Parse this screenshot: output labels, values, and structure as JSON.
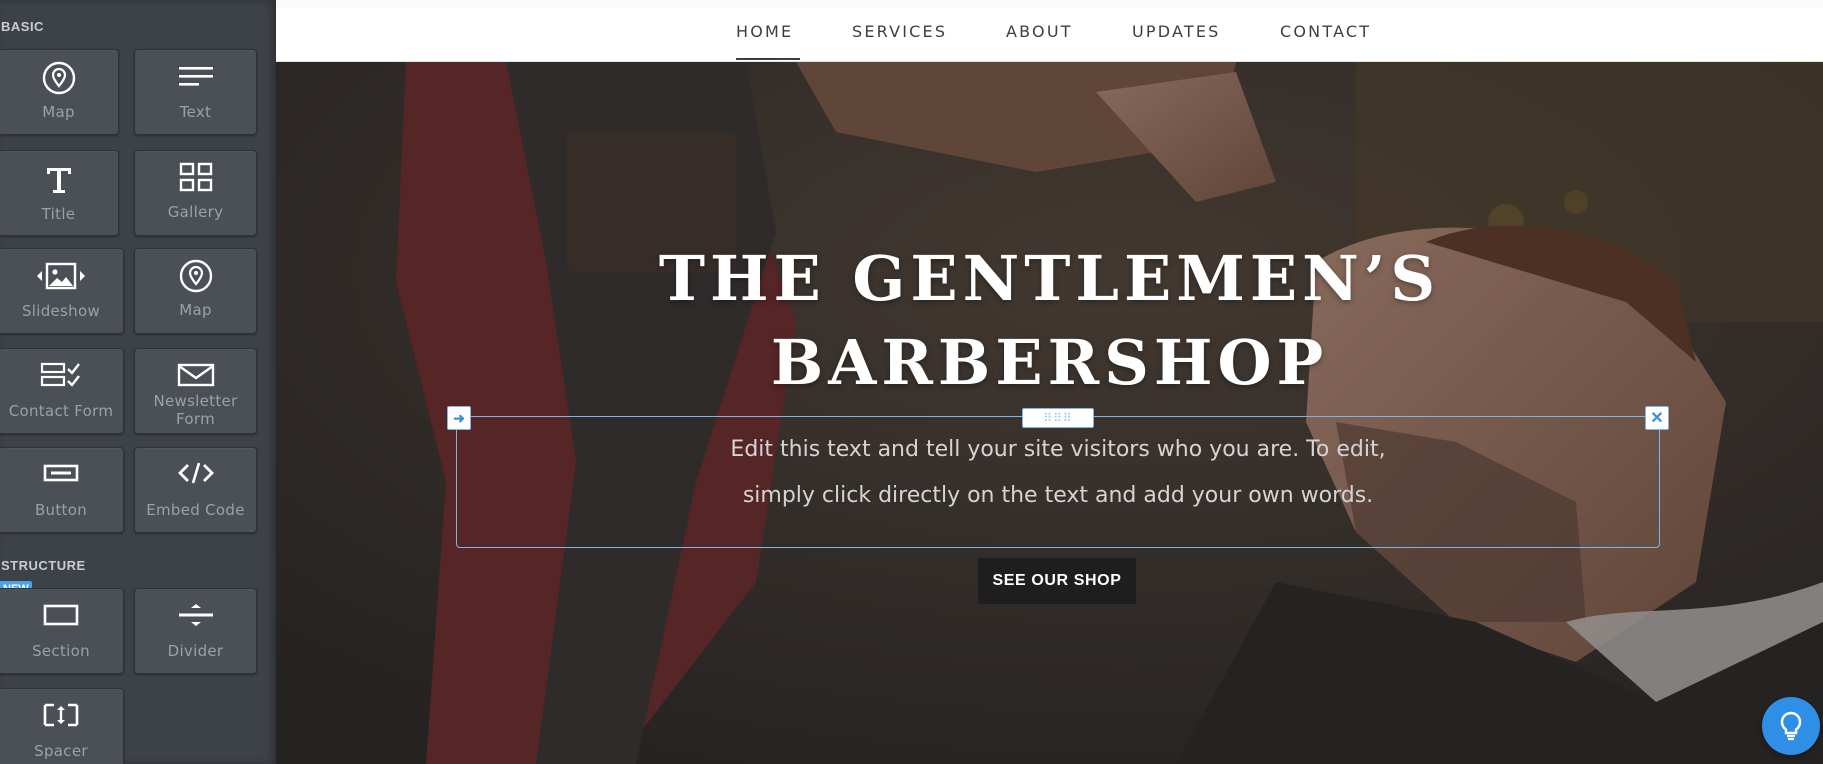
{
  "sidebar": {
    "basic_label": "BASIC",
    "structure_label": "STRUCTURE",
    "new_badge": "NEW",
    "tiles": [
      {
        "label": "Map",
        "icon": "map-pin-icon"
      },
      {
        "label": "Text",
        "icon": "text-lines-icon"
      },
      {
        "label": "Title",
        "icon": "title-t-icon"
      },
      {
        "label": "Gallery",
        "icon": "gallery-grid-icon"
      },
      {
        "label": "Slideshow",
        "icon": "slideshow-icon"
      },
      {
        "label": "Map",
        "icon": "map-pin-icon"
      },
      {
        "label": "Contact Form",
        "icon": "contact-form-icon"
      },
      {
        "label": "Newsletter Form",
        "icon": "envelope-icon"
      },
      {
        "label": "Button",
        "icon": "button-icon"
      },
      {
        "label": "Embed Code",
        "icon": "code-icon"
      },
      {
        "label": "Section",
        "icon": "section-icon"
      },
      {
        "label": "Divider",
        "icon": "divider-icon"
      },
      {
        "label": "Spacer",
        "icon": "spacer-icon"
      }
    ]
  },
  "nav": {
    "items": [
      "HOME",
      "SERVICES",
      "ABOUT",
      "UPDATES",
      "CONTACT"
    ],
    "active": "HOME"
  },
  "hero": {
    "title_line1": "THE GENTLEMEN’S",
    "title_line2": "BARBERSHOP",
    "edit_text_line1": "Edit this text and tell your site visitors who you are. To edit,",
    "edit_text_line2": "simply click directly on the text and add your own words.",
    "button_label": "SEE OUR SHOP"
  },
  "colors": {
    "sidebar_bg": "#3d4247",
    "tile_bg": "#4a5056",
    "accent_blue": "#2f8ee6",
    "selection_border": "#7db6e6"
  }
}
